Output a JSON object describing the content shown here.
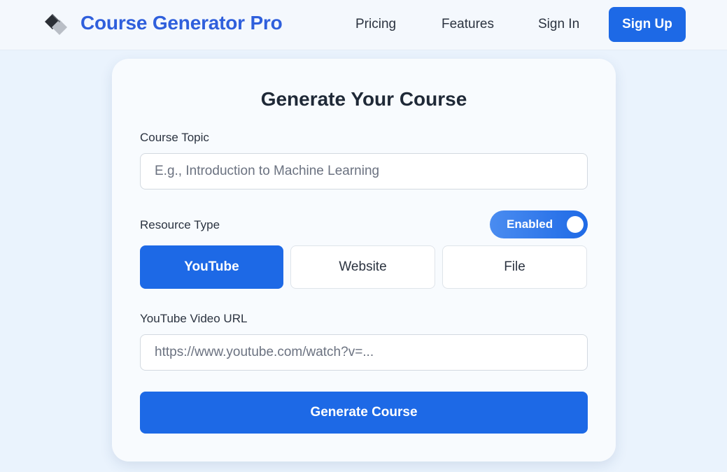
{
  "navbar": {
    "logo_icon": "stacked-diamond-logo-icon",
    "brand": "Course Generator Pro",
    "links": [
      "Pricing",
      "Features",
      "Sign In"
    ],
    "signup_label": "Sign Up"
  },
  "form": {
    "title": "Generate Your Course",
    "topic_label": "Course Topic",
    "topic_placeholder": "E.g., Introduction to Machine Learning",
    "topic_value": "",
    "resource_label": "Resource Type",
    "toggle_label": "Enabled",
    "toggle_on": true,
    "resource_types": [
      "YouTube",
      "Website",
      "File"
    ],
    "selected_resource": "YouTube",
    "url_label": "YouTube Video URL",
    "url_placeholder": "https://www.youtube.com/watch?v=...",
    "url_value": "",
    "submit_label": "Generate Course"
  },
  "colors": {
    "accent": "#1d69e6",
    "brand_text": "#2f5fdc",
    "background": "#eaf3fd",
    "card": "#f8fbfe"
  }
}
